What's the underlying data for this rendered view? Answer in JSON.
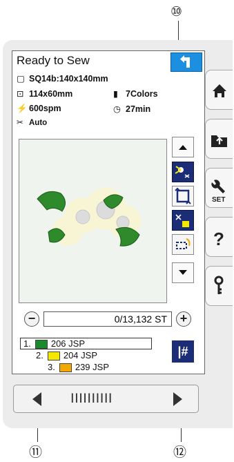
{
  "callouts": {
    "top": "⑩",
    "bottom_left": "⑪",
    "bottom_right": "⑫"
  },
  "screen": {
    "title": "Ready to Sew",
    "back_icon": "return-arrow-icon",
    "info": {
      "design": "SQ14b:140x140mm",
      "size": "114x60mm",
      "colors": "7Colors",
      "speed": "600spm",
      "time": "27min",
      "thread_cutting": "Auto"
    },
    "tool_icons": [
      "scroll-up-icon",
      "thread-trim-icon",
      "trace-icon",
      "skip-color-icon",
      "jog-icon",
      "scroll-down-icon"
    ],
    "stitch_counter": "0/13,132 ST",
    "minus_label": "−",
    "plus_label": "+",
    "color_list": [
      {
        "index": "1.",
        "code": "206 JSP",
        "color": "#1a8a2a"
      },
      {
        "index": "2.",
        "code": "204 JSP",
        "color": "#f5e800"
      },
      {
        "index": "3.",
        "code": "239 JSP",
        "color": "#f5a800"
      }
    ],
    "jump_label": "|#"
  },
  "side_buttons": [
    "home-icon",
    "folder-out-icon",
    "set-icon",
    "help-icon",
    "key-icon"
  ],
  "set_label": "SET",
  "jog_label": "IIIIIIIIII"
}
